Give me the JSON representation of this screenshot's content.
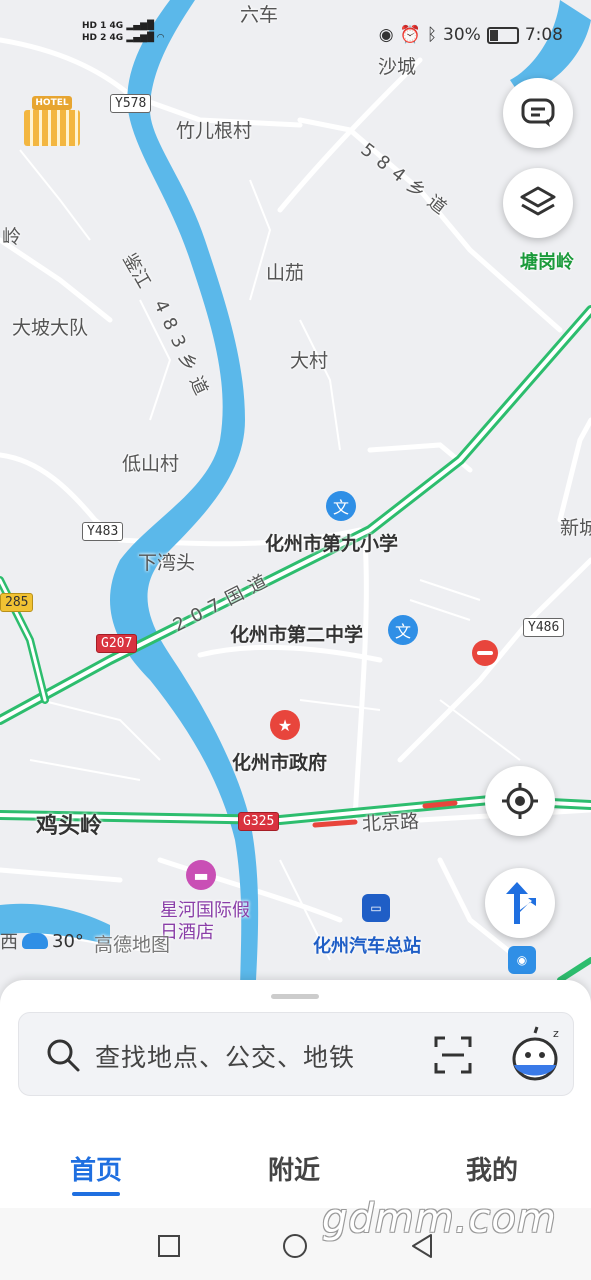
{
  "status_bar": {
    "sim1": "HD 1",
    "sim2": "HD 2",
    "net1": "4G",
    "net2": "4G",
    "battery": "30%",
    "time": "7:08"
  },
  "map": {
    "places": {
      "liuche": "六车",
      "shacheng": "沙城",
      "zhuergencun": "竹儿根村",
      "ling_left": "岭",
      "tanggangling": "塘岗岭",
      "shanqie": "山茄",
      "dapodadui": "大坡大队",
      "dacun": "大村",
      "dishancun": "低山村",
      "xiawantou": "下湾头",
      "xincheng": "新城",
      "jitouling": "鸡头岭"
    },
    "rivers": {
      "jianjiang": "鉴江"
    },
    "roads": {
      "road_584": "584乡道",
      "road_483": "483乡道",
      "road_207": "207国道",
      "beijing_road": "北京路"
    },
    "shields": {
      "y578": "Y578",
      "y483": "Y483",
      "y486": "Y486",
      "g207": "G207",
      "g325": "G325",
      "s285": "285"
    },
    "pois": {
      "school9": "化州市第九小学",
      "school2": "化州市第二中学",
      "govt": "化州市政府",
      "hotel": "星河国际假日酒店",
      "bus_station": "化州汽车总站",
      "hotel_badge": "HOTEL"
    },
    "weather": {
      "prefix": "西",
      "temp": "30°"
    },
    "provider_logo": "高德地图"
  },
  "search": {
    "placeholder": "查找地点、公交、地铁"
  },
  "tabs": [
    {
      "label": "首页",
      "active": true
    },
    {
      "label": "附近",
      "active": false
    },
    {
      "label": "我的",
      "active": false
    }
  ],
  "watermark": "gdmm.com",
  "colors": {
    "accent": "#1f6fe0",
    "river": "#5bb8ea",
    "highway": "#2dbd6e",
    "govt_red": "#e8453c"
  },
  "icons": [
    "message-icon",
    "layers-icon",
    "locate-icon",
    "navigation-icon",
    "scan-icon",
    "assistant-icon",
    "search-icon"
  ]
}
